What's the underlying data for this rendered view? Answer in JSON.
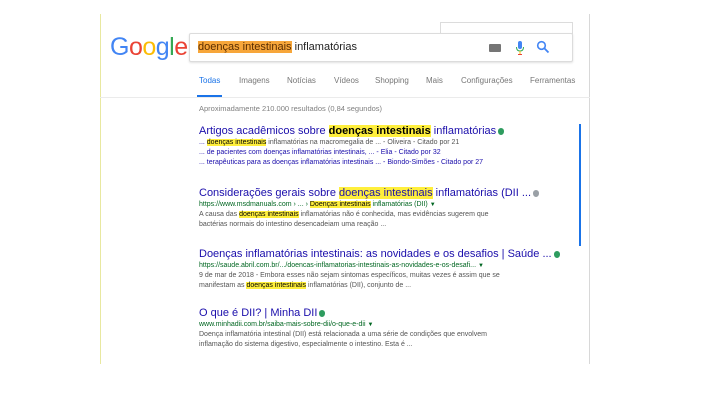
{
  "logo": {
    "letters": [
      "G",
      "o",
      "o",
      "g",
      "l",
      "e"
    ]
  },
  "search": {
    "query_highlight": "doenças intestinais",
    "query_rest": " inflamatórias"
  },
  "tabs": [
    {
      "label": "Todas",
      "active": true
    },
    {
      "label": "Imagens"
    },
    {
      "label": "Notícias"
    },
    {
      "label": "Vídeos"
    },
    {
      "label": "Shopping"
    },
    {
      "label": "Mais"
    },
    {
      "label": "Configurações"
    },
    {
      "label": "Ferramentas"
    }
  ],
  "stats": "Aproximadamente 210.000 resultados (0,84 segundos)",
  "results": [
    {
      "title_pre": "Artigos acadêmicos sobre ",
      "title_hl": "doenças intestinais",
      "title_post": " inflamatórias",
      "lines": [
        {
          "pre": "... ",
          "hl": "doenças intestinais",
          "post": " inflamatórias na macromegalia de ... - Oliveira - Citado por 21"
        },
        {
          "pre": "... de pacientes com doenças inflamatórias intestinais, ... - Elia - Citado por 32",
          "hl": "",
          "post": ""
        },
        {
          "pre": "... terapêuticas para as doenças inflamatórias intestinais ... - Biondo-Simões - Citado por 27",
          "hl": "",
          "post": ""
        }
      ]
    },
    {
      "title_pre": "Considerações gerais sobre ",
      "title_hl": "doenças intestinais",
      "title_post": " inflamatórias (DII ...",
      "url_pre": "https://www.msdmanuals.com › ... › ",
      "url_hl": "Doenças intestinais",
      "url_post": " inflamatórias (DII)",
      "lines": [
        {
          "pre": "A causa das ",
          "hl": "doenças intestinais",
          "post": " inflamatórias não é conhecida, mas evidências sugerem que"
        },
        {
          "pre": "bactérias normais do intestino desencadeiam uma reação ...",
          "hl": "",
          "post": ""
        }
      ]
    },
    {
      "title": "Doenças inflamatórias intestinais: as novidades e os desafios | Saúde ...",
      "url": "https://saude.abril.com.br/.../doencas-inflamatorias-intestinais-as-novidades-e-os-desafi...",
      "lines": [
        {
          "pre": "9 de mar de 2018 - Embora esses não sejam sintomas específicos, muitas vezes é assim que se",
          "hl": "",
          "post": ""
        },
        {
          "pre": "manifestam as ",
          "hl": "doenças intestinais",
          "post": " inflamatórias (DII), conjunto de ..."
        }
      ]
    },
    {
      "title": "O que é DII? | Minha DII",
      "url": "www.minhadii.com.br/saiba-mais-sobre-dii/o-que-e-dii",
      "lines": [
        {
          "pre": "Doença inflamatória intestinal (DII) está relacionada a uma série de condições que envolvem",
          "hl": "",
          "post": ""
        },
        {
          "pre": "inflamação do sistema digestivo, especialmente o intestino. Esta é ...",
          "hl": "",
          "post": ""
        }
      ]
    }
  ],
  "colors": {
    "link": "#1a0dab",
    "url": "#006621",
    "snippet": "#545454",
    "highlight": "#ffef3c",
    "query_highlight": "#f7a63a",
    "accent": "#1a73e8",
    "verified_badge": "#2e9c5f"
  },
  "icons": [
    "keyboard-icon",
    "microphone-icon",
    "search-icon",
    "verified-badge-icon",
    "dropdown-arrow-icon"
  ]
}
